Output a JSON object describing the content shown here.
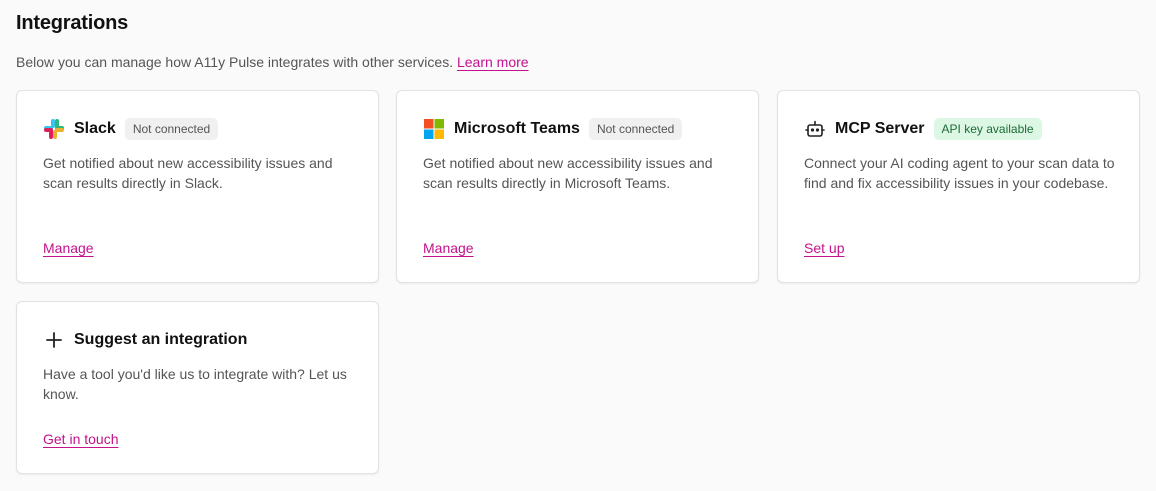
{
  "header": {
    "title": "Integrations",
    "intro": "Below you can manage how A11y Pulse integrates with other services.",
    "learn_more": "Learn more"
  },
  "cards": [
    {
      "title": "Slack",
      "badge": "Not connected",
      "description": "Get notified about new accessibility issues and scan results directly in Slack.",
      "action": "Manage",
      "icon": "slack-icon"
    },
    {
      "title": "Microsoft Teams",
      "badge": "Not connected",
      "description": "Get notified about new accessibility issues and scan results directly in Microsoft Teams.",
      "action": "Manage",
      "icon": "microsoft-teams-icon"
    },
    {
      "title": "MCP Server",
      "badge": "API key available",
      "description": "Connect your AI coding agent to your scan data to find and fix accessibility issues in your codebase.",
      "action": "Set up",
      "icon": "robot-icon"
    },
    {
      "title": "Suggest an integration",
      "description": "Have a tool you'd like us to integrate with? Let us know.",
      "action": "Get in touch",
      "icon": "plus-icon"
    }
  ],
  "colors": {
    "link": "#c4128c",
    "badge_gray_bg": "#f0f0f0",
    "badge_green_bg": "#dcf7e3",
    "badge_green_text": "#1d6b38"
  }
}
